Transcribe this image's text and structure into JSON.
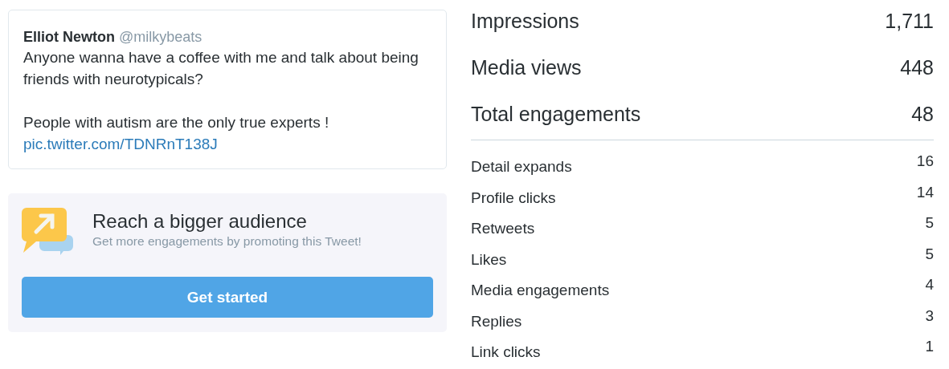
{
  "tweet": {
    "name": "Elliot Newton",
    "handle": "@milkybeats",
    "paragraphs": [
      "Anyone wanna have a coffee with me and talk about being friends with neurotypicals?",
      "People with autism are the only true experts !"
    ],
    "link": "pic.twitter.com/TDNRnT138J"
  },
  "promo": {
    "title": "Reach a bigger audience",
    "subtitle": "Get more engagements by promoting this Tweet!",
    "button": "Get started"
  },
  "metrics": [
    {
      "label": "Impressions",
      "value": "1,711"
    },
    {
      "label": "Media views",
      "value": "448"
    },
    {
      "label": "Total engagements",
      "value": "48"
    }
  ],
  "engagements": [
    {
      "label": "Detail expands",
      "value": "16"
    },
    {
      "label": "Profile clicks",
      "value": "14"
    },
    {
      "label": "Retweets",
      "value": "5"
    },
    {
      "label": "Likes",
      "value": "5"
    },
    {
      "label": "Media engagements",
      "value": "4"
    },
    {
      "label": "Replies",
      "value": "3"
    },
    {
      "label": "Link clicks",
      "value": "1"
    }
  ]
}
